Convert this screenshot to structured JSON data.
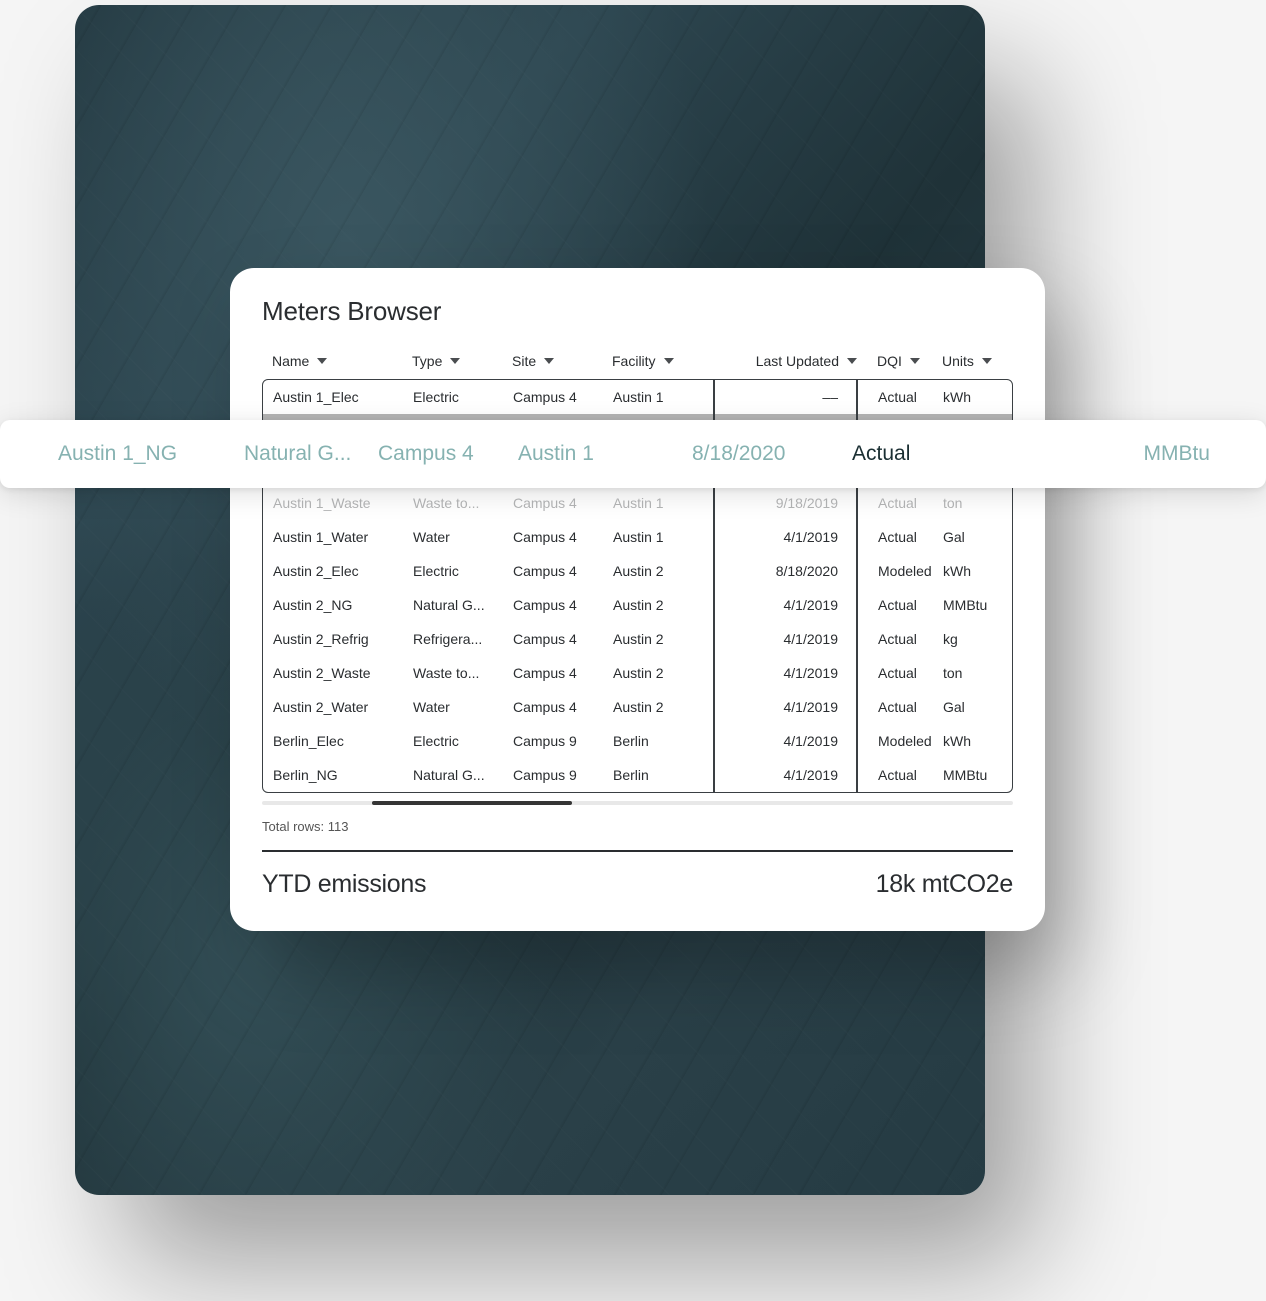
{
  "card": {
    "title": "Meters Browser"
  },
  "columns": {
    "c0": "Name",
    "c1": "Type",
    "c2": "Site",
    "c3": "Facility",
    "c4": "Last Updated",
    "c5": "DQI",
    "c6": "Units"
  },
  "rows": [
    {
      "name": "Austin 1_Elec",
      "type": "Electric",
      "site": "Campus 4",
      "facility": "Austin 1",
      "date": "––",
      "dqi": "Actual",
      "units": "kWh"
    },
    {
      "name": "Austin 1_Waste",
      "type": "Waste to...",
      "site": "Campus 4",
      "facility": "Austin 1",
      "date": "9/18/2019",
      "dqi": "Actual",
      "units": "ton"
    },
    {
      "name": "Austin 1_Water",
      "type": "Water",
      "site": "Campus 4",
      "facility": "Austin 1",
      "date": "4/1/2019",
      "dqi": "Actual",
      "units": "Gal"
    },
    {
      "name": "Austin 2_Elec",
      "type": "Electric",
      "site": "Campus 4",
      "facility": "Austin 2",
      "date": "8/18/2020",
      "dqi": "Modeled",
      "units": "kWh"
    },
    {
      "name": "Austin 2_NG",
      "type": "Natural G...",
      "site": "Campus 4",
      "facility": "Austin 2",
      "date": "4/1/2019",
      "dqi": "Actual",
      "units": "MMBtu"
    },
    {
      "name": "Austin 2_Refrig",
      "type": "Refrigera...",
      "site": "Campus 4",
      "facility": "Austin 2",
      "date": "4/1/2019",
      "dqi": "Actual",
      "units": "kg"
    },
    {
      "name": "Austin 2_Waste",
      "type": "Waste to...",
      "site": "Campus 4",
      "facility": "Austin 2",
      "date": "4/1/2019",
      "dqi": "Actual",
      "units": "ton"
    },
    {
      "name": "Austin 2_Water",
      "type": "Water",
      "site": "Campus 4",
      "facility": "Austin 2",
      "date": "4/1/2019",
      "dqi": "Actual",
      "units": "Gal"
    },
    {
      "name": "Berlin_Elec",
      "type": "Electric",
      "site": "Campus 9",
      "facility": "Berlin",
      "date": "4/1/2019",
      "dqi": "Modeled",
      "units": "kWh"
    },
    {
      "name": "Berlin_NG",
      "type": "Natural G...",
      "site": "Campus 9",
      "facility": "Berlin",
      "date": "4/1/2019",
      "dqi": "Actual",
      "units": "MMBtu"
    }
  ],
  "highlight": {
    "name": "Austin 1_NG",
    "type": "Natural G...",
    "site": "Campus 4",
    "facility": "Austin 1",
    "date": "8/18/2020",
    "dqi": "Actual",
    "units": "MMBtu"
  },
  "footer": {
    "total_label": "Total rows: 113",
    "ytd_label": "YTD emissions",
    "ytd_value": "18k mtCO2e"
  }
}
